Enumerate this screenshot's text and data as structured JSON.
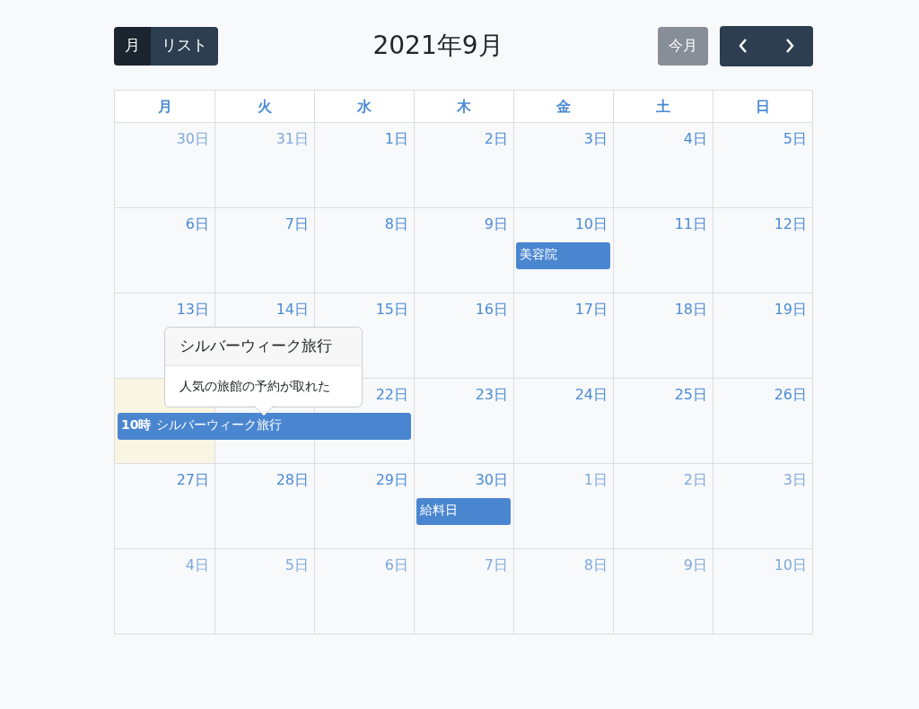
{
  "toolbar": {
    "views": [
      {
        "label": "月",
        "selected": true
      },
      {
        "label": "リスト",
        "selected": false
      }
    ],
    "title": "2021年9月",
    "today_button": {
      "label": "今月",
      "disabled": true
    }
  },
  "weekdays": [
    "月",
    "火",
    "水",
    "木",
    "金",
    "土",
    "日"
  ],
  "weeks": [
    {
      "days": [
        {
          "label": "30日",
          "other_month": true,
          "today": false
        },
        {
          "label": "31日",
          "other_month": true,
          "today": false
        },
        {
          "label": "1日",
          "other_month": false,
          "today": false
        },
        {
          "label": "2日",
          "other_month": false,
          "today": false
        },
        {
          "label": "3日",
          "other_month": false,
          "today": false
        },
        {
          "label": "4日",
          "other_month": false,
          "today": false
        },
        {
          "label": "5日",
          "other_month": false,
          "today": false
        }
      ]
    },
    {
      "days": [
        {
          "label": "6日",
          "other_month": false,
          "today": false
        },
        {
          "label": "7日",
          "other_month": false,
          "today": false
        },
        {
          "label": "8日",
          "other_month": false,
          "today": false
        },
        {
          "label": "9日",
          "other_month": false,
          "today": false
        },
        {
          "label": "10日",
          "other_month": false,
          "today": false,
          "event": {
            "title": "美容院"
          }
        },
        {
          "label": "11日",
          "other_month": false,
          "today": false
        },
        {
          "label": "12日",
          "other_month": false,
          "today": false
        }
      ]
    },
    {
      "days": [
        {
          "label": "13日",
          "other_month": false,
          "today": false
        },
        {
          "label": "14日",
          "other_month": false,
          "today": false
        },
        {
          "label": "15日",
          "other_month": false,
          "today": false
        },
        {
          "label": "16日",
          "other_month": false,
          "today": false
        },
        {
          "label": "17日",
          "other_month": false,
          "today": false
        },
        {
          "label": "18日",
          "other_month": false,
          "today": false
        },
        {
          "label": "19日",
          "other_month": false,
          "today": false
        }
      ]
    },
    {
      "days": [
        {
          "other_month": false,
          "today": true,
          "event": {
            "time": "10時",
            "title": "シルバーウィーク旅行"
          }
        },
        {
          "other_month": false,
          "today": false,
          "event_continues": true
        },
        {
          "label": "22日",
          "other_month": false,
          "today": false,
          "event_continues": true
        },
        {
          "label": "23日",
          "other_month": false,
          "today": false
        },
        {
          "label": "24日",
          "other_month": false,
          "today": false
        },
        {
          "label": "25日",
          "other_month": false,
          "today": false
        },
        {
          "label": "26日",
          "other_month": false,
          "today": false
        }
      ]
    },
    {
      "days": [
        {
          "label": "27日",
          "other_month": false,
          "today": false
        },
        {
          "label": "28日",
          "other_month": false,
          "today": false
        },
        {
          "label": "29日",
          "other_month": false,
          "today": false
        },
        {
          "label": "30日",
          "other_month": false,
          "today": false,
          "event": {
            "title": "給料日"
          }
        },
        {
          "label": "1日",
          "other_month": true,
          "today": false
        },
        {
          "label": "2日",
          "other_month": true,
          "today": false
        },
        {
          "label": "3日",
          "other_month": true,
          "today": false
        }
      ]
    },
    {
      "days": [
        {
          "label": "4日",
          "other_month": true,
          "today": false
        },
        {
          "label": "5日",
          "other_month": true,
          "today": false
        },
        {
          "label": "6日",
          "other_month": true,
          "today": false
        },
        {
          "label": "7日",
          "other_month": true,
          "today": false
        },
        {
          "label": "8日",
          "other_month": true,
          "today": false
        },
        {
          "label": "9日",
          "other_month": true,
          "today": false
        },
        {
          "label": "10日",
          "other_month": true,
          "today": false
        }
      ]
    }
  ],
  "popover": {
    "title": "シルバーウィーク旅行",
    "body": "人気の旅館の予約が取れた"
  }
}
